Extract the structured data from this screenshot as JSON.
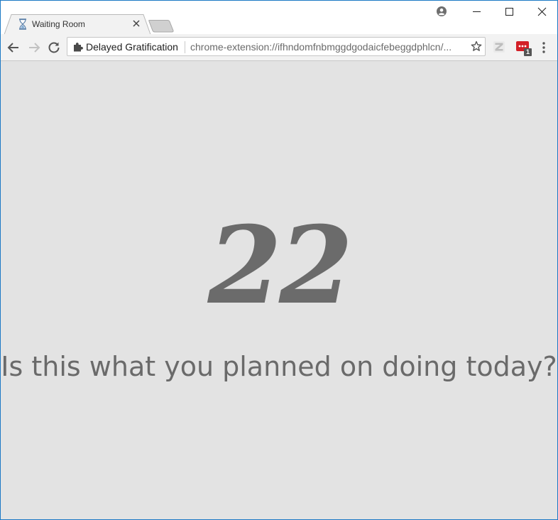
{
  "browser": {
    "tab": {
      "title": "Waiting Room",
      "favicon": "hourglass-icon"
    },
    "omnibox": {
      "site_label": "Delayed Gratification",
      "url": "chrome-extension://ifhndomfnbmggdgodaicfebeggdphlcn/..."
    },
    "extensions": [
      {
        "icon": "z-extension-icon"
      },
      {
        "icon": "password-extension-icon",
        "badge": "1"
      }
    ]
  },
  "page": {
    "counter": "22",
    "question": "Is this what you planned on doing today?"
  },
  "colors": {
    "content_background": "#e3e3e3",
    "text": "#6b6b6b",
    "window_border": "#1c79c5",
    "extension_red": "#d32027"
  }
}
